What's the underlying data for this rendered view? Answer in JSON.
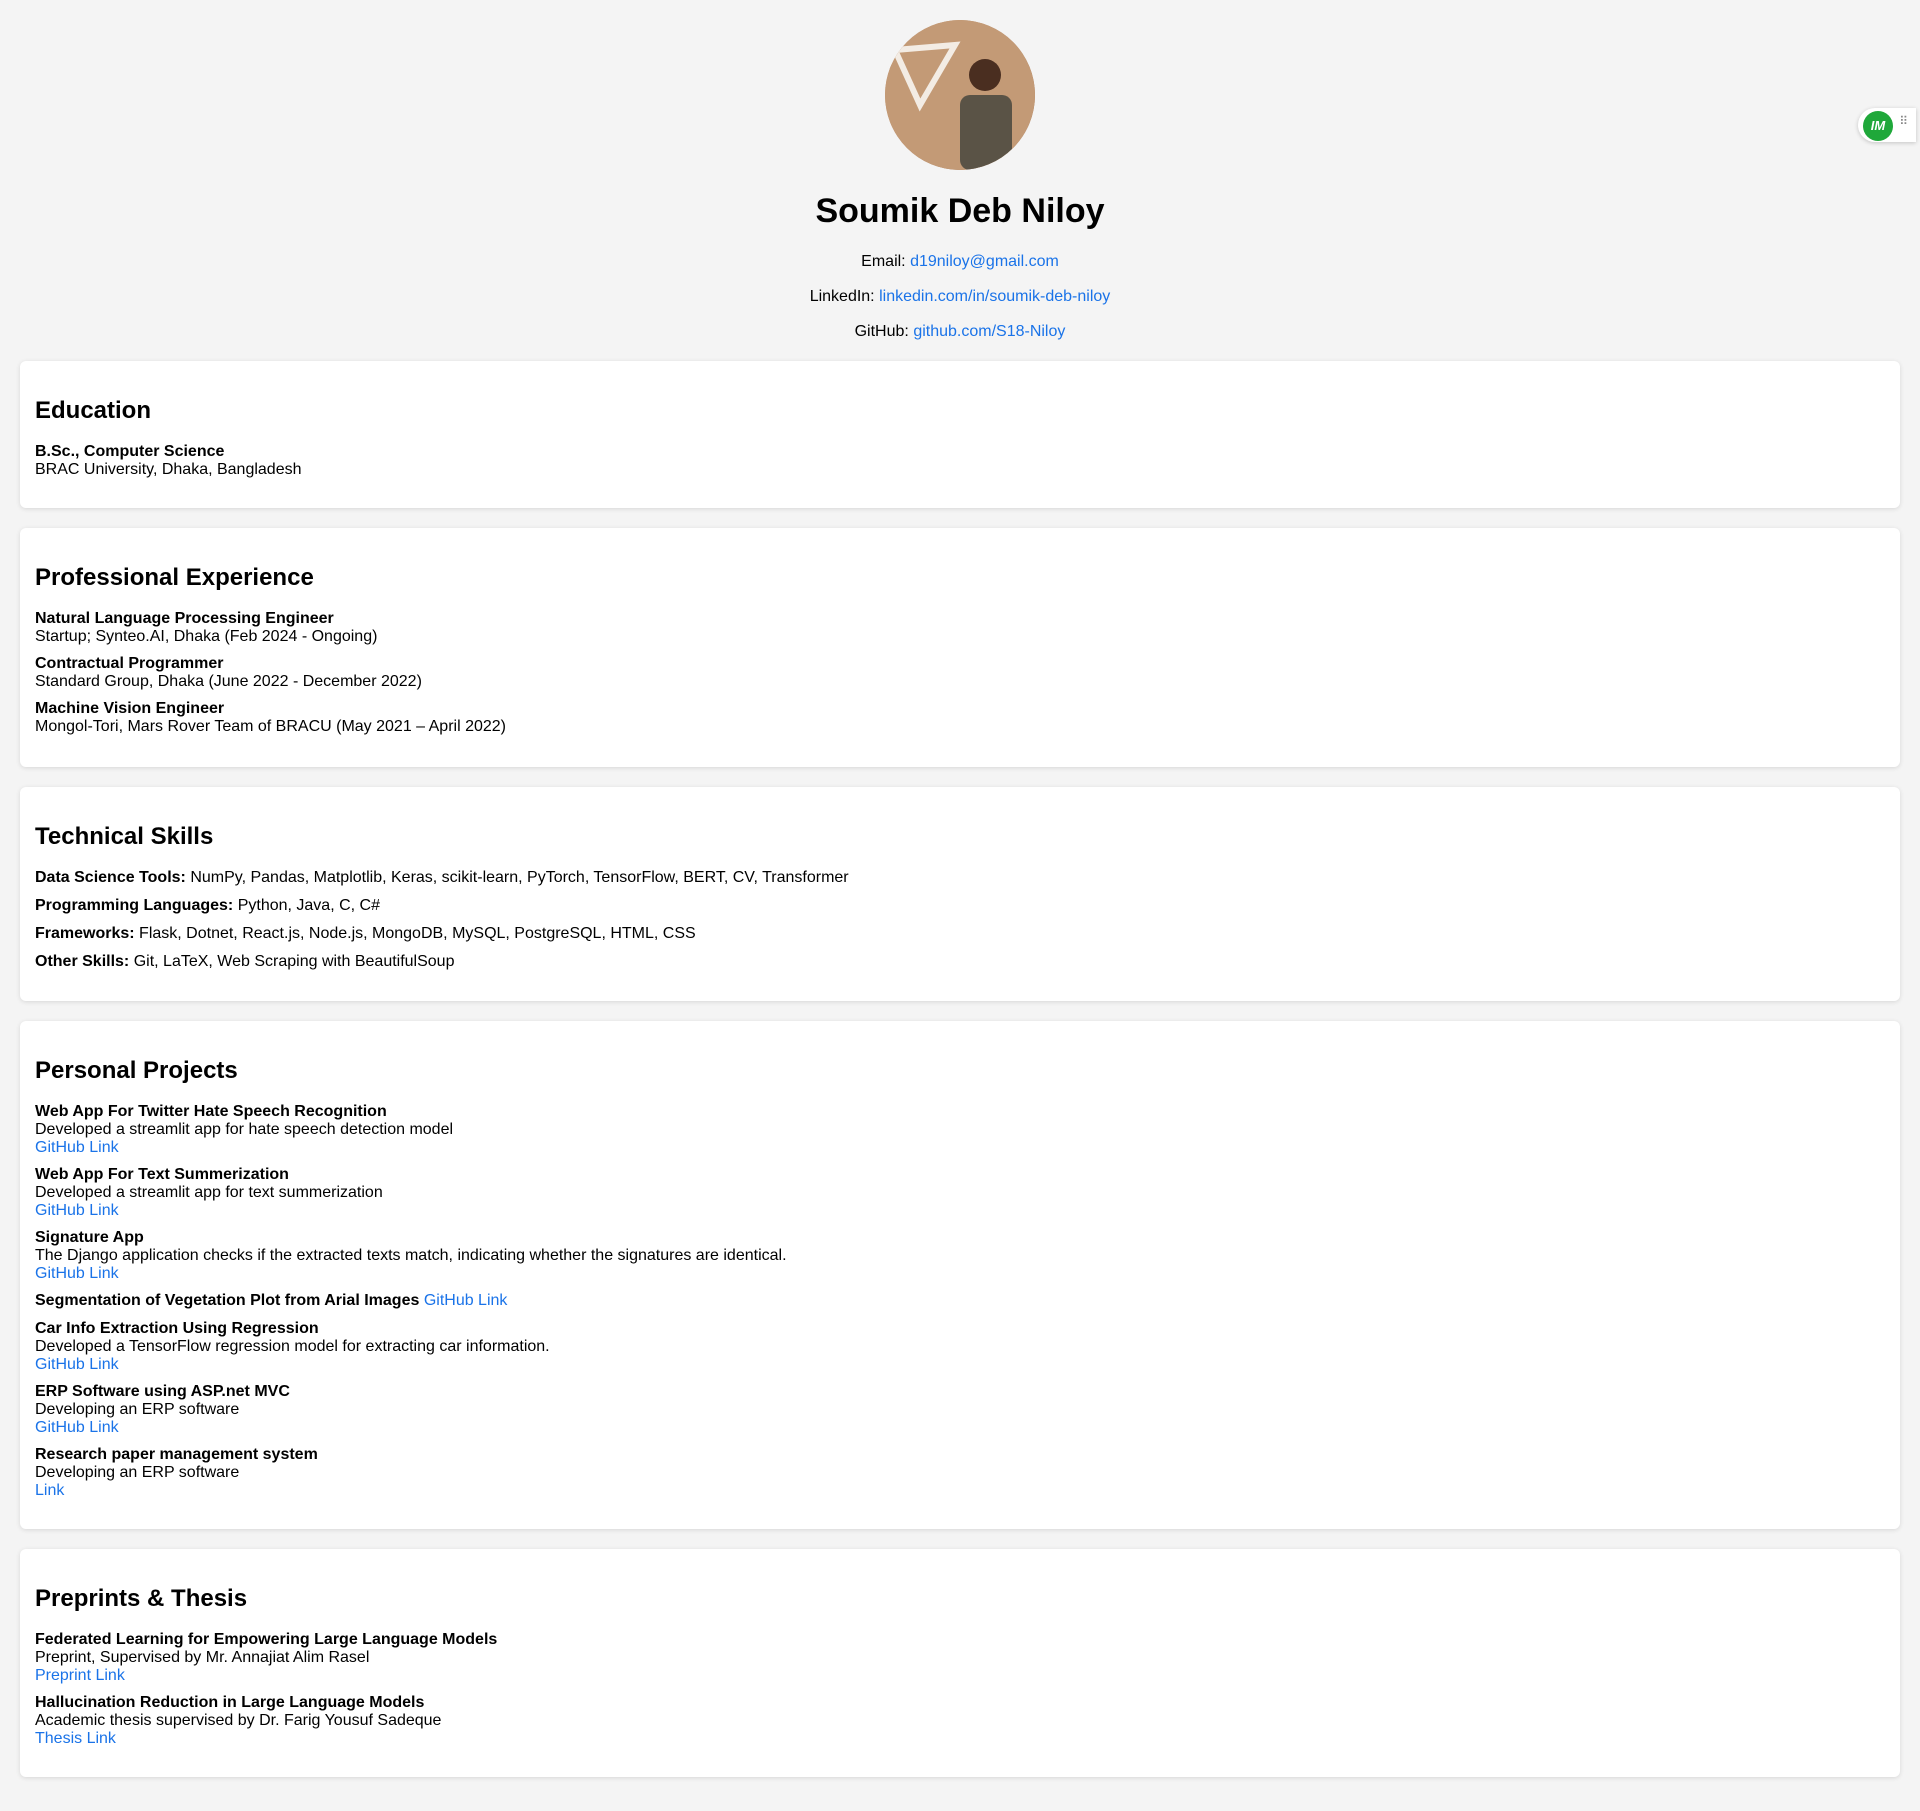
{
  "header": {
    "name": "Soumik Deb Niloy",
    "email_label": "Email:",
    "email_value": "d19niloy@gmail.com",
    "linkedin_label": "LinkedIn:",
    "linkedin_value": "linkedin.com/in/soumik-deb-niloy",
    "github_label": "GitHub:",
    "github_value": "github.com/S18-Niloy"
  },
  "education": {
    "heading": "Education",
    "items": [
      {
        "title": "B.Sc., Computer Science",
        "detail": "BRAC University, Dhaka, Bangladesh"
      }
    ]
  },
  "experience": {
    "heading": "Professional Experience",
    "items": [
      {
        "title": "Natural Language Processing Engineer",
        "detail": "Startup; Synteo.AI, Dhaka (Feb 2024 - Ongoing)"
      },
      {
        "title": "Contractual Programmer",
        "detail": "Standard Group, Dhaka (June 2022 - December 2022)"
      },
      {
        "title": "Machine Vision Engineer",
        "detail": "Mongol-Tori, Mars Rover Team of BRACU (May 2021 – April 2022)"
      }
    ]
  },
  "skills": {
    "heading": "Technical Skills",
    "items": [
      {
        "label": "Data Science Tools:",
        "value": "NumPy, Pandas, Matplotlib, Keras, scikit-learn, PyTorch, TensorFlow, BERT, CV, Transformer"
      },
      {
        "label": "Programming Languages:",
        "value": "Python, Java, C, C#"
      },
      {
        "label": "Frameworks:",
        "value": "Flask, Dotnet, React.js, Node.js, MongoDB, MySQL, PostgreSQL, HTML, CSS"
      },
      {
        "label": "Other Skills:",
        "value": "Git, LaTeX, Web Scraping with BeautifulSoup"
      }
    ]
  },
  "projects": {
    "heading": "Personal Projects",
    "items": [
      {
        "title": "Web App For Twitter Hate Speech Recognition",
        "detail": "Developed a streamlit app for hate speech detection model",
        "link": "GitHub Link"
      },
      {
        "title": "Web App For Text Summerization",
        "detail": "Developed a streamlit app for text summerization",
        "link": "GitHub Link"
      },
      {
        "title": "Signature App",
        "detail": "The Django application checks if the extracted texts match, indicating whether the signatures are identical.",
        "link": "GitHub Link"
      },
      {
        "title": "Segmentation of Vegetation Plot from Arial Images",
        "inline_link": "GitHub Link"
      },
      {
        "title": "Car Info Extraction Using Regression",
        "detail": "Developed a TensorFlow regression model for extracting car information.",
        "link": "GitHub Link"
      },
      {
        "title": "ERP Software using ASP.net MVC",
        "detail": "Developing an ERP software",
        "link": "GitHub Link"
      },
      {
        "title": "Research paper management system",
        "detail": "Developing an ERP software",
        "link": "Link"
      }
    ]
  },
  "preprints": {
    "heading": "Preprints & Thesis",
    "items": [
      {
        "title": "Federated Learning for Empowering Large Language Models",
        "detail": "Preprint, Supervised by Mr. Annajiat Alim Rasel",
        "link": "Preprint Link"
      },
      {
        "title": "Hallucination Reduction in Large Language Models",
        "detail": "Academic thesis supervised by Dr. Farig Yousuf Sadeque",
        "link": "Thesis Link"
      }
    ]
  },
  "extension_widget": {
    "logo_text": "IM",
    "icon": "drag-handle-icon"
  }
}
